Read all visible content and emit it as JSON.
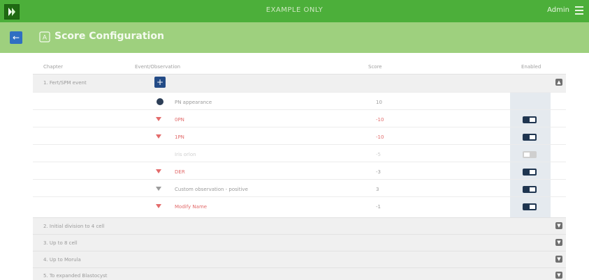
{
  "topbar": {
    "center_title": "EXAMPLE ONLY",
    "admin_label": "Admin"
  },
  "subbar": {
    "title": "Score Configuration"
  },
  "table": {
    "headers": {
      "chapter": "Chapter",
      "event": "Event/Observation",
      "score": "Score",
      "enabled": "Enabled"
    },
    "chapters": [
      {
        "label": "1.   Fert/SPM event"
      },
      {
        "label": "2.   Initial division to 4 cell"
      },
      {
        "label": "3.   Up to 8 cell"
      },
      {
        "label": "4.   Up to Morula"
      },
      {
        "label": "5.   To expanded Blastocyst"
      }
    ],
    "rows": [
      {
        "event": "PN appearance",
        "score": "10",
        "style": "normal",
        "enabled": true
      },
      {
        "event": "0PN",
        "score": "-10",
        "style": "red",
        "enabled": true
      },
      {
        "event": "1PN",
        "score": "-10",
        "style": "red",
        "enabled": true
      },
      {
        "event": "Iris orlon",
        "score": "-5",
        "style": "muted",
        "enabled": false
      },
      {
        "event": "DER",
        "score": "-3",
        "style": "red",
        "enabled": true
      },
      {
        "event": "Custom observation - positive",
        "score": "3",
        "style": "normal",
        "enabled": true
      },
      {
        "event": "Modify Name",
        "score": "-1",
        "style": "red",
        "enabled": true
      }
    ]
  },
  "icons": {
    "logo": "logo-icon",
    "menu": "menu-icon",
    "back": "back-arrow-icon",
    "title": "score-icon",
    "add": "plus-icon",
    "collapse": "chevron-up-icon",
    "expand": "chevron-down-icon",
    "toggle": "toggle-icon"
  },
  "colors": {
    "primary_green": "#4caf3a",
    "secondary_green": "#9ed07e",
    "accent_blue": "#234b86",
    "danger_red": "#e26a6a"
  }
}
